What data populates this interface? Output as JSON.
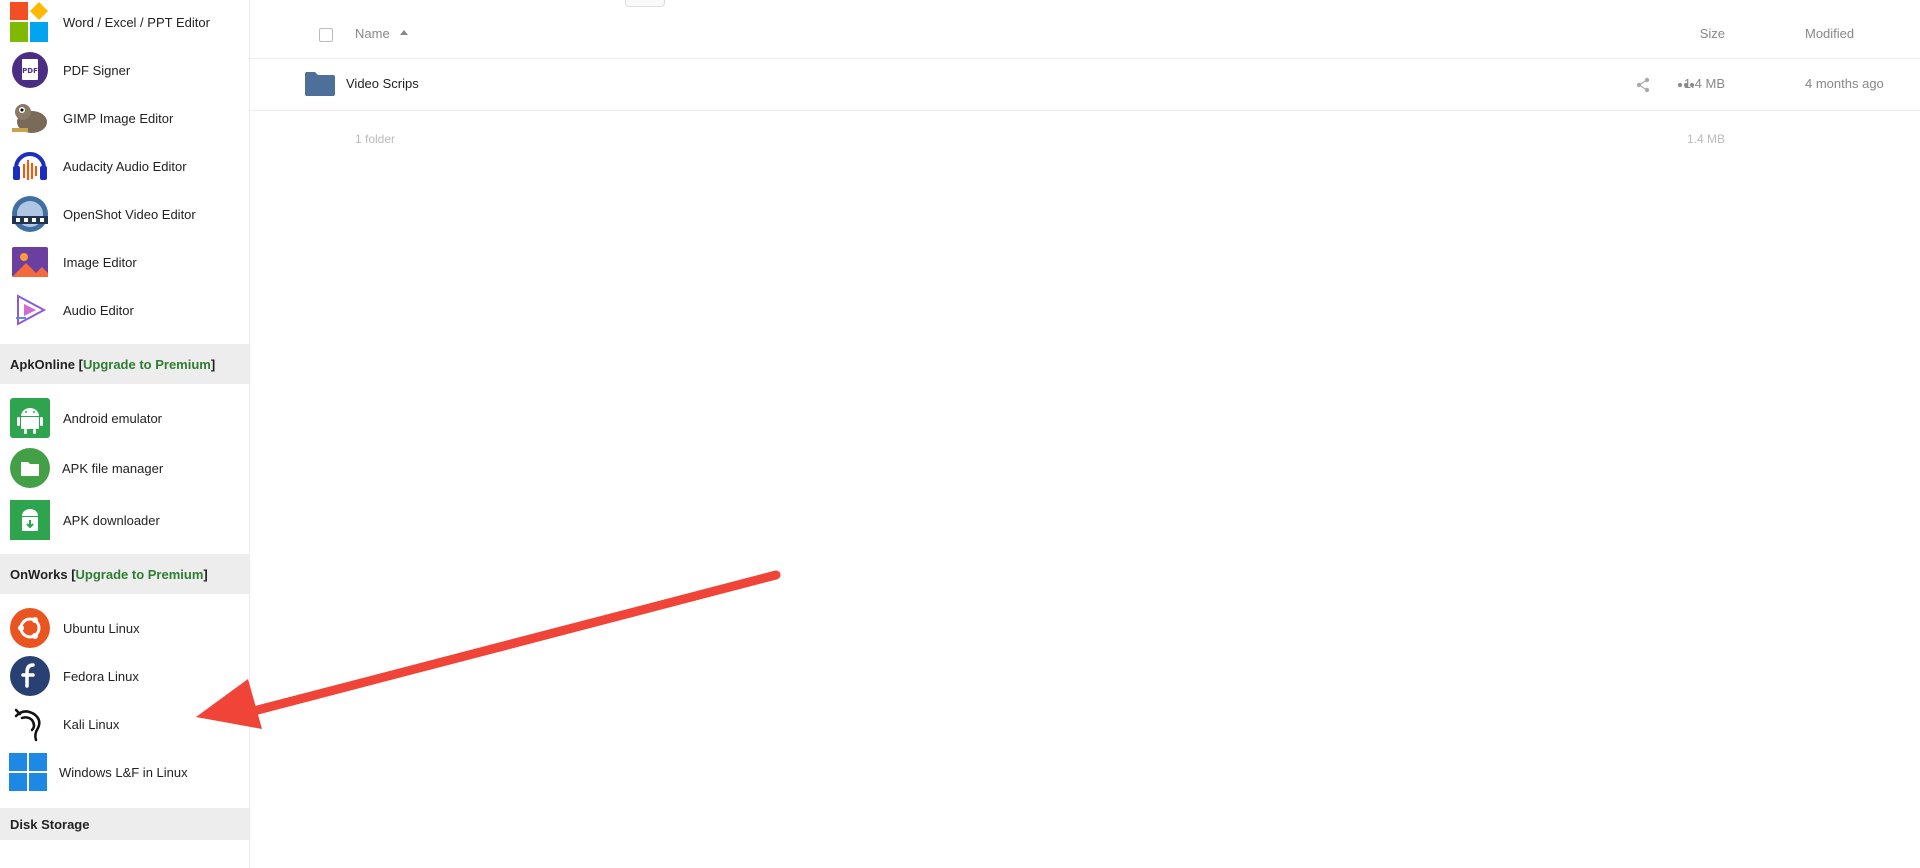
{
  "sidebar": {
    "apps_top": [
      {
        "label": "Word / Excel / PPT Editor",
        "icon": "office-icon"
      },
      {
        "label": "PDF Signer",
        "icon": "pdf-icon"
      },
      {
        "label": "GIMP Image Editor",
        "icon": "gimp-icon"
      },
      {
        "label": "Audacity Audio Editor",
        "icon": "audacity-icon"
      },
      {
        "label": "OpenShot Video Editor",
        "icon": "openshot-icon"
      },
      {
        "label": "Image Editor",
        "icon": "image-icon"
      },
      {
        "label": "Audio Editor",
        "icon": "audio-icon"
      }
    ],
    "apkonline": {
      "title": "ApkOnline",
      "upgrade": "Upgrade to Premium",
      "items": [
        {
          "label": "Android emulator",
          "icon": "android-icon"
        },
        {
          "label": "APK file manager",
          "icon": "file-manager-icon"
        },
        {
          "label": "APK downloader",
          "icon": "apk-download-icon"
        }
      ]
    },
    "onworks": {
      "title": "OnWorks",
      "upgrade": "Upgrade to Premium",
      "items": [
        {
          "label": "Ubuntu Linux",
          "icon": "ubuntu-icon"
        },
        {
          "label": "Fedora Linux",
          "icon": "fedora-icon"
        },
        {
          "label": "Kali Linux",
          "icon": "kali-icon"
        },
        {
          "label": "Windows L&F in Linux",
          "icon": "windows-icon"
        }
      ]
    },
    "disk_storage": {
      "title": "Disk Storage"
    }
  },
  "filelist": {
    "header": {
      "name": "Name",
      "size": "Size",
      "modified": "Modified"
    },
    "rows": [
      {
        "name": "Video Scrips",
        "size": "1.4 MB",
        "modified": "4 months ago"
      }
    ],
    "summary": {
      "count": "1 folder",
      "size": "1.4 MB"
    }
  },
  "colors": {
    "upgrade": "#2e7d32",
    "folder": "#4f6f9b",
    "section_bg": "#ededed",
    "annotation_arrow": "#f04438"
  }
}
